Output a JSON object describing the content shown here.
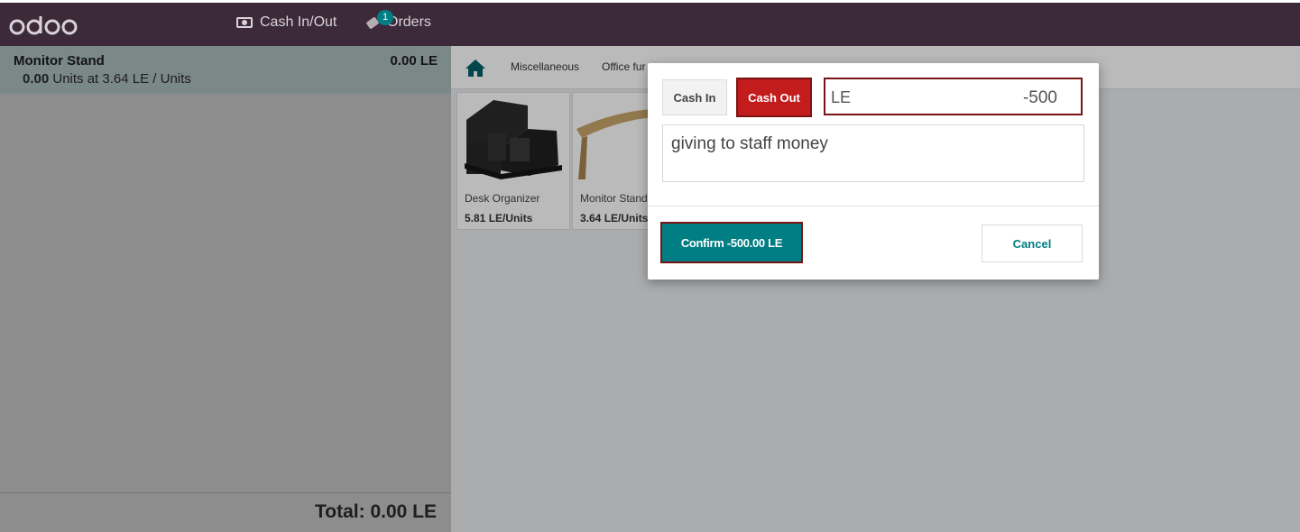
{
  "header": {
    "logo_text": "odoo",
    "nav": {
      "cash_label": "Cash In/Out",
      "orders_label": "Orders",
      "orders_badge": "1"
    }
  },
  "order": {
    "line": {
      "name": "Monitor Stand",
      "price": "0.00 LE",
      "quantity": "0.00",
      "unit_info": "Units at 3.64 LE / Units"
    },
    "total_label": "Total:",
    "total_value": "0.00 LE"
  },
  "categories": {
    "home_icon": "home-icon",
    "items": [
      "Miscellaneous",
      "Office fur"
    ]
  },
  "products": [
    {
      "name": "Desk Organizer",
      "price": "5.81 LE/Units"
    },
    {
      "name": "Monitor Stand",
      "price": "3.64 LE/Units"
    }
  ],
  "dialog": {
    "cash_in_label": "Cash In",
    "cash_out_label": "Cash Out",
    "currency": "LE",
    "amount": "-500",
    "reason": "giving to staff money",
    "confirm_label": "Confirm -500.00 LE",
    "cancel_label": "Cancel"
  },
  "colors": {
    "topbar": "#3c2a3a",
    "accent": "#017e84",
    "cash_out": "#c21c1c",
    "highlight_border": "#7a1414"
  }
}
